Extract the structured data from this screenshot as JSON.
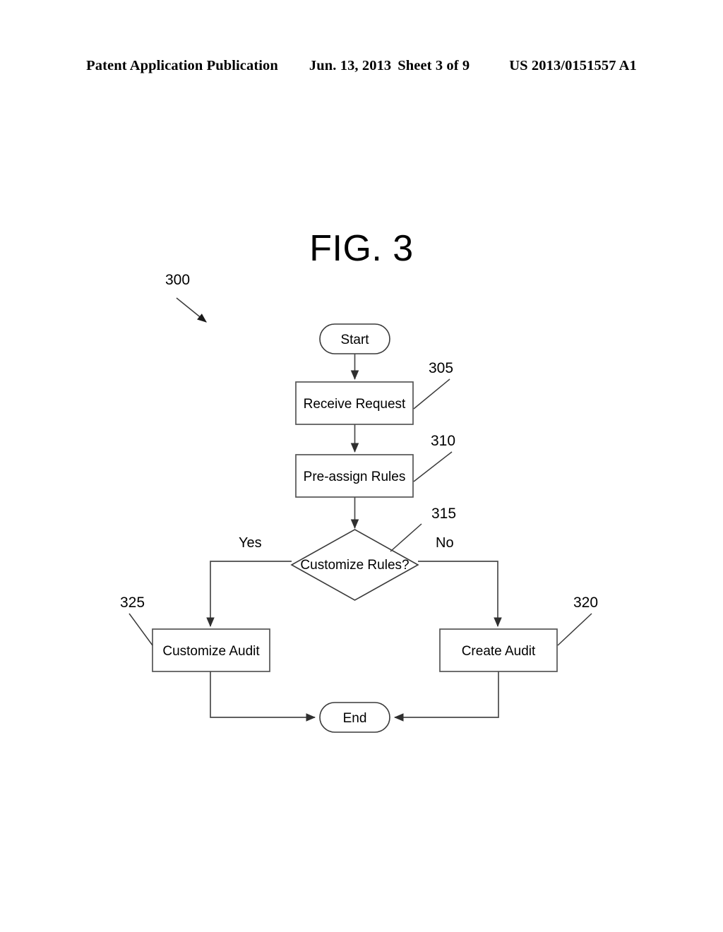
{
  "header": {
    "publication": "Patent Application Publication",
    "date": "Jun. 13, 2013",
    "sheet": "Sheet 3 of 9",
    "document_number": "US 2013/0151557 A1"
  },
  "figure": {
    "title": "FIG. 3",
    "diagram_reference": "300"
  },
  "flowchart": {
    "nodes": {
      "start": {
        "label": "Start",
        "shape": "terminator"
      },
      "receive_request": {
        "label": "Receive Request",
        "shape": "process",
        "ref": "305"
      },
      "pre_assign_rules": {
        "label": "Pre-assign Rules",
        "shape": "process",
        "ref": "310"
      },
      "decision": {
        "label": "Customize Rules?",
        "shape": "decision",
        "ref": "315"
      },
      "customize_audit": {
        "label": "Customize Audit",
        "shape": "process",
        "ref": "325"
      },
      "create_audit": {
        "label": "Create Audit",
        "shape": "process",
        "ref": "320"
      },
      "end": {
        "label": "End",
        "shape": "terminator"
      }
    },
    "branches": {
      "yes": "Yes",
      "no": "No"
    },
    "reference_numerals": {
      "diagram": "300",
      "receive_request": "305",
      "pre_assign_rules": "310",
      "decision": "315",
      "create_audit": "320",
      "customize_audit": "325"
    },
    "colors": {
      "line": "#3a3a3a",
      "fill": "#ffffff",
      "text": "#000000"
    }
  }
}
